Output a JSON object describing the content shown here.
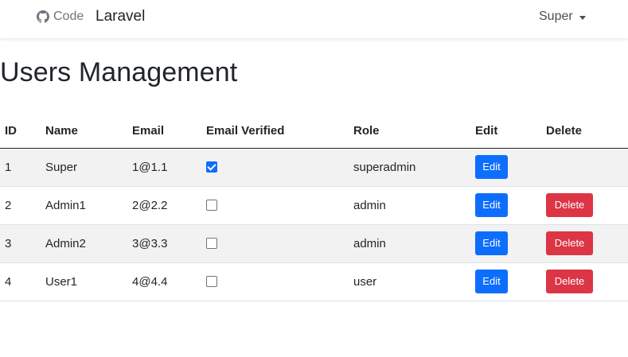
{
  "navbar": {
    "code_label": "Code",
    "brand": "Laravel",
    "user_menu_label": "Super"
  },
  "page": {
    "title": "Users Management"
  },
  "table": {
    "headers": {
      "id": "ID",
      "name": "Name",
      "email": "Email",
      "verified": "Email Verified",
      "role": "Role",
      "edit": "Edit",
      "delete": "Delete"
    },
    "rows": [
      {
        "id": "1",
        "name": "Super",
        "email": "1@1.1",
        "verified": true,
        "role": "superadmin",
        "edit_label": "Edit",
        "delete_label": ""
      },
      {
        "id": "2",
        "name": "Admin1",
        "email": "2@2.2",
        "verified": false,
        "role": "admin",
        "edit_label": "Edit",
        "delete_label": "Delete"
      },
      {
        "id": "3",
        "name": "Admin2",
        "email": "3@3.3",
        "verified": false,
        "role": "admin",
        "edit_label": "Edit",
        "delete_label": "Delete"
      },
      {
        "id": "4",
        "name": "User1",
        "email": "4@4.4",
        "verified": false,
        "role": "user",
        "edit_label": "Edit",
        "delete_label": "Delete"
      }
    ]
  },
  "colors": {
    "primary": "#0d6efd",
    "danger": "#dc3545",
    "stripe": "#f2f2f2"
  }
}
